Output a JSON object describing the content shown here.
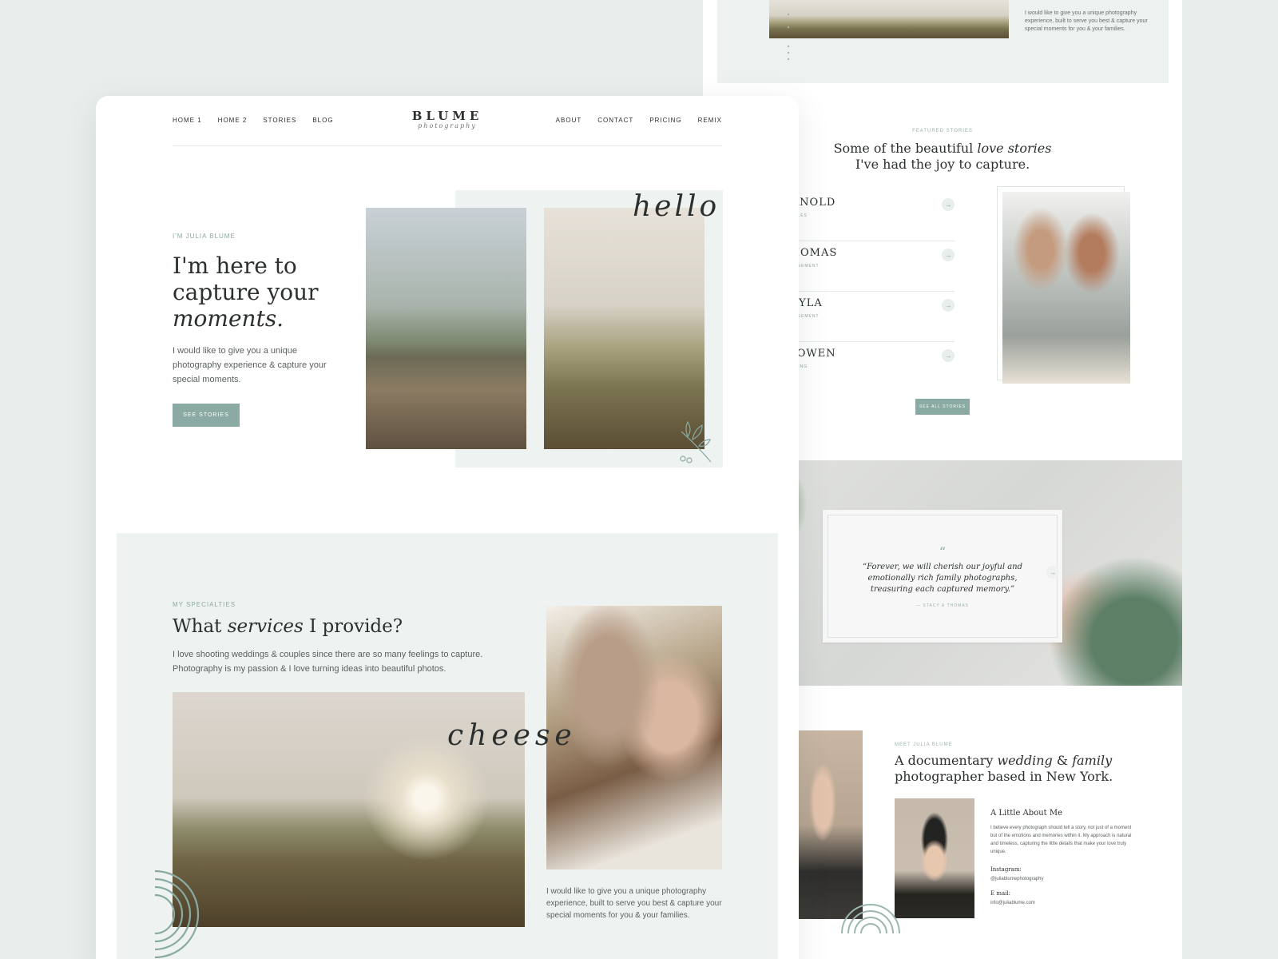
{
  "colors": {
    "accent": "#8aaaa3",
    "background": "#e9eeec",
    "panel": "#eef2f1",
    "text": "#2b2f2e"
  },
  "bg_page": {
    "top_text": "I would like to give you a unique photography experience, built to serve you best & capture your special moments for you & your families.",
    "featured": {
      "label": "FEATURED STORIES",
      "title_pre": "Some of the beautiful ",
      "title_em": "love stories",
      "title_post": "I've had the joy to capture.",
      "stories": [
        {
          "name": "ARNOLD",
          "category": "COUPLES",
          "arrow": "→"
        },
        {
          "name": "THOMAS",
          "category": "ENGAGEMENT",
          "arrow": "→"
        },
        {
          "name": "LEYLA",
          "category": "ENGAGEMENT",
          "arrow": "→"
        },
        {
          "name": "& OWEN",
          "category": "WEDDING",
          "arrow": "→"
        }
      ],
      "see_all": "SEE ALL STORIES"
    },
    "testimonial": {
      "quote_mark": "“",
      "quote": "“Forever, we will cherish our joyful and emotionally rich family photographs, treasuring each captured memory.”",
      "author": "—  STACY & THOMAS",
      "next": "→"
    },
    "about": {
      "label": "MEET JULIA BLUME",
      "title_pre": "A documentary ",
      "title_em1": "wedding",
      "title_mid": " & ",
      "title_em2": "family",
      "title_post": " photographer based in New York.",
      "heading": "A Little About Me",
      "body": "I believe every photograph should tell a story, not just of a moment but of the emotions and memories within it. My approach is natural and timeless, capturing the little details that make your love truly unique.",
      "instagram_label": "Instagram:",
      "instagram": "@juliablumephotography",
      "email_label": "E mail:",
      "email": "info@juliablume.com"
    }
  },
  "nav": {
    "left": [
      "HOME 1",
      "HOME 2",
      "STORIES",
      "BLOG"
    ],
    "right": [
      "ABOUT",
      "CONTACT",
      "PRICING",
      "REMIX"
    ],
    "logo": "BLUME",
    "logo_sub": "photography"
  },
  "hero": {
    "label": "I'M JULIA BLUME",
    "title_line1": "I'm here to capture your",
    "title_em": "moments.",
    "body": "I would like to give you a unique photography experience & capture your special moments.",
    "button": "SEE STORIES",
    "script": "hello"
  },
  "services": {
    "label": "MY SPECIALTIES",
    "title_pre": "What ",
    "title_em": "services",
    "title_post": " I provide?",
    "body": "I love shooting weddings & couples since there are so many feelings to capture. Photography is my passion & I love turning ideas into beautiful photos.",
    "script": "cheese",
    "caption": "I would like to give you a unique photography experience, built to serve you best & capture your special moments for you & your families."
  }
}
